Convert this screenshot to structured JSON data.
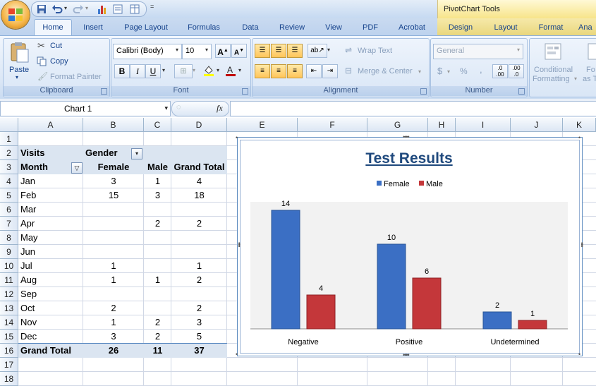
{
  "title_bar": {
    "contextual_tab_group": "PivotChart Tools",
    "qat_more": "="
  },
  "tabs": [
    "Home",
    "Insert",
    "Page Layout",
    "Formulas",
    "Data",
    "Review",
    "View",
    "PDF",
    "Acrobat",
    "Design",
    "Layout",
    "Format",
    "Ana"
  ],
  "ribbon": {
    "clipboard": {
      "label": "Clipboard",
      "paste": "Paste",
      "cut": "Cut",
      "copy": "Copy",
      "format_painter": "Format Painter"
    },
    "font": {
      "label": "Font",
      "family": "Calibri (Body)",
      "size": "10"
    },
    "alignment": {
      "label": "Alignment",
      "wrap_text": "Wrap Text",
      "merge_center": "Merge & Center"
    },
    "number": {
      "label": "Number",
      "format": "General",
      "percent": "%",
      "comma": ","
    },
    "styles": {
      "conditional_1": "Conditional",
      "conditional_2": "Formatting",
      "format_as_1": "Fo",
      "format_as_2": "as T"
    }
  },
  "formula_bar": {
    "name_box": "Chart 1",
    "fx": "fx",
    "value": ""
  },
  "columns": [
    "A",
    "B",
    "C",
    "D",
    "E",
    "F",
    "G",
    "H",
    "I",
    "J",
    "K"
  ],
  "rows": [
    "1",
    "2",
    "3",
    "4",
    "5",
    "6",
    "7",
    "8",
    "9",
    "10",
    "11",
    "12",
    "13",
    "14",
    "15",
    "16",
    "17",
    "18"
  ],
  "pivot": {
    "row2": {
      "a": "Visits",
      "b": "Gender"
    },
    "headers": {
      "a": "Month",
      "b": "Female",
      "c": "Male",
      "d": "Grand Total"
    },
    "data": [
      {
        "month": "Jan",
        "female": "3",
        "male": "1",
        "total": "4"
      },
      {
        "month": "Feb",
        "female": "15",
        "male": "3",
        "total": "18"
      },
      {
        "month": "Mar",
        "female": "",
        "male": "",
        "total": ""
      },
      {
        "month": "Apr",
        "female": "",
        "male": "2",
        "total": "2"
      },
      {
        "month": "May",
        "female": "",
        "male": "",
        "total": ""
      },
      {
        "month": "Jun",
        "female": "",
        "male": "",
        "total": ""
      },
      {
        "month": "Jul",
        "female": "1",
        "male": "",
        "total": "1"
      },
      {
        "month": "Aug",
        "female": "1",
        "male": "1",
        "total": "2"
      },
      {
        "month": "Sep",
        "female": "",
        "male": "",
        "total": ""
      },
      {
        "month": "Oct",
        "female": "2",
        "male": "",
        "total": "2"
      },
      {
        "month": "Nov",
        "female": "1",
        "male": "2",
        "total": "3"
      },
      {
        "month": "Dec",
        "female": "3",
        "male": "2",
        "total": "5"
      }
    ],
    "grand_total": {
      "label": "Grand Total",
      "female": "26",
      "male": "11",
      "total": "37"
    }
  },
  "chart_data": {
    "type": "bar",
    "title": "Test Results",
    "categories": [
      "Negative",
      "Positive",
      "Undetermined"
    ],
    "series": [
      {
        "name": "Female",
        "values": [
          14,
          10,
          2
        ],
        "color": "#3b6fc4"
      },
      {
        "name": "Male",
        "values": [
          4,
          6,
          1
        ],
        "color": "#c4373a"
      }
    ],
    "ylim": [
      0,
      15
    ],
    "legend": "top",
    "grid": false,
    "plot_background": "#f2f2f2"
  }
}
